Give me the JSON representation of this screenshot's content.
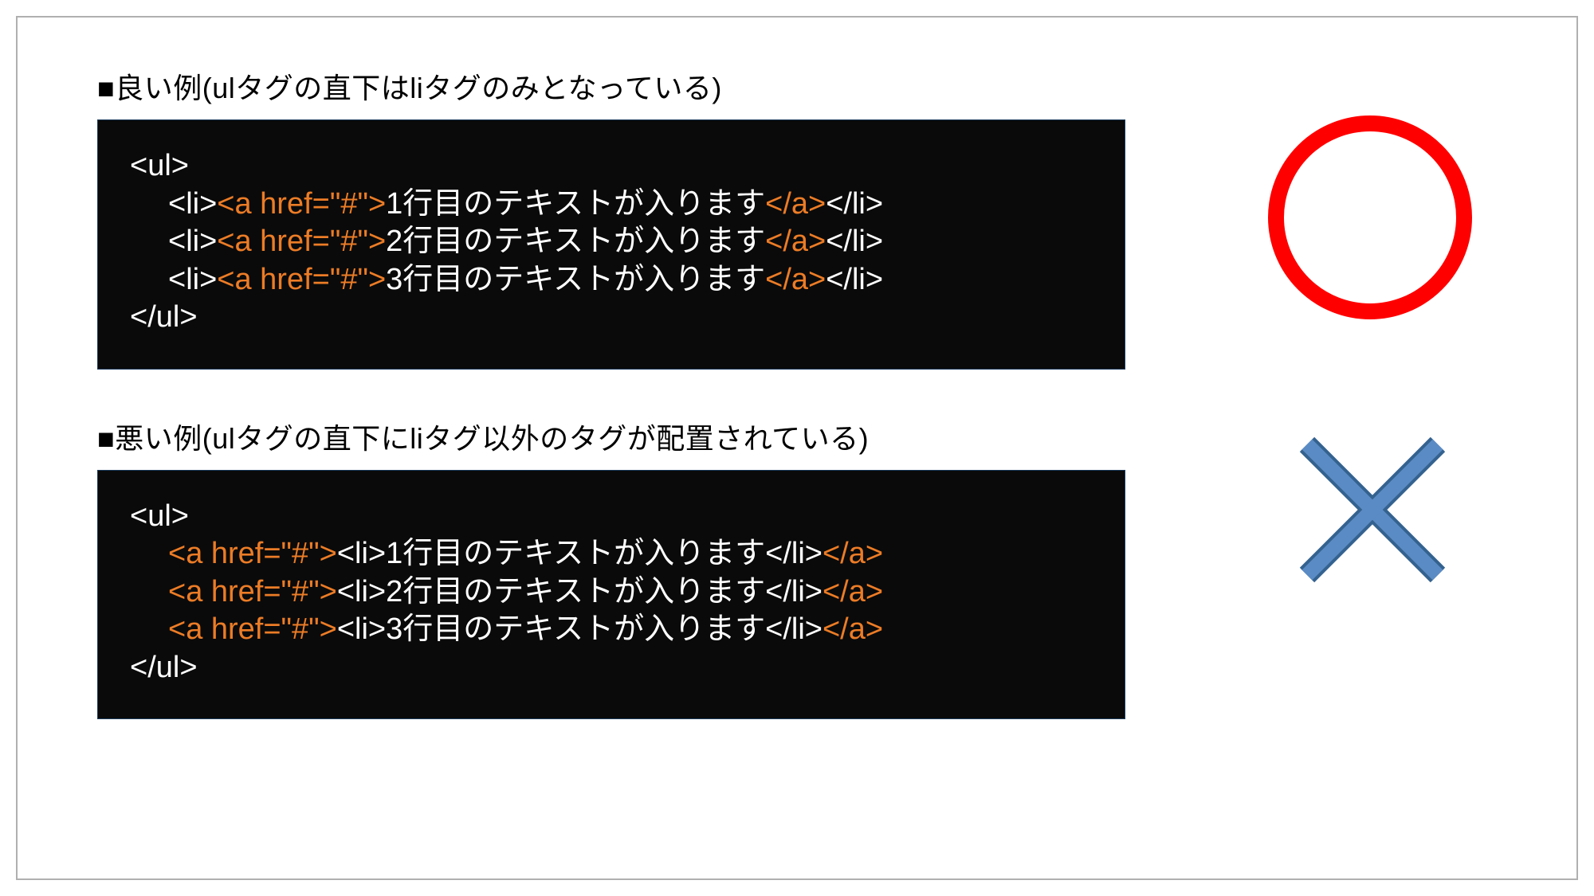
{
  "colors": {
    "tag_white": "#ffffff",
    "tag_orange": "#ec7c26",
    "circle_red": "#ff0000",
    "cross_blue": "#4a7ebb"
  },
  "good": {
    "title": "■良い例(ulタグの直下はliタグのみとなっている)",
    "ul_open": "<ul>",
    "ul_close": "</ul>",
    "rows": [
      {
        "li_open": "<li>",
        "a_open": "<a href=\"#\">",
        "text": "1行目のテキストが入ります",
        "a_close": "</a>",
        "li_close": "</li>"
      },
      {
        "li_open": "<li>",
        "a_open": "<a href=\"#\">",
        "text": "2行目のテキストが入ります",
        "a_close": "</a>",
        "li_close": "</li>"
      },
      {
        "li_open": "<li>",
        "a_open": "<a href=\"#\">",
        "text": "3行目のテキストが入ります",
        "a_close": "</a>",
        "li_close": "</li>"
      }
    ]
  },
  "bad": {
    "title": "■悪い例(ulタグの直下にliタグ以外のタグが配置されている)",
    "ul_open": "<ul>",
    "ul_close": "</ul>",
    "rows": [
      {
        "a_open": "<a href=\"#\">",
        "li_open": "<li>",
        "text": "1行目のテキストが入ります",
        "li_close": "</li>",
        "a_close": "</a>"
      },
      {
        "a_open": "<a href=\"#\">",
        "li_open": "<li>",
        "text": "2行目のテキストが入ります",
        "li_close": "</li>",
        "a_close": "</a>"
      },
      {
        "a_open": "<a href=\"#\">",
        "li_open": "<li>",
        "text": "3行目のテキストが入ります",
        "li_close": "</li>",
        "a_close": "</a>"
      }
    ]
  }
}
